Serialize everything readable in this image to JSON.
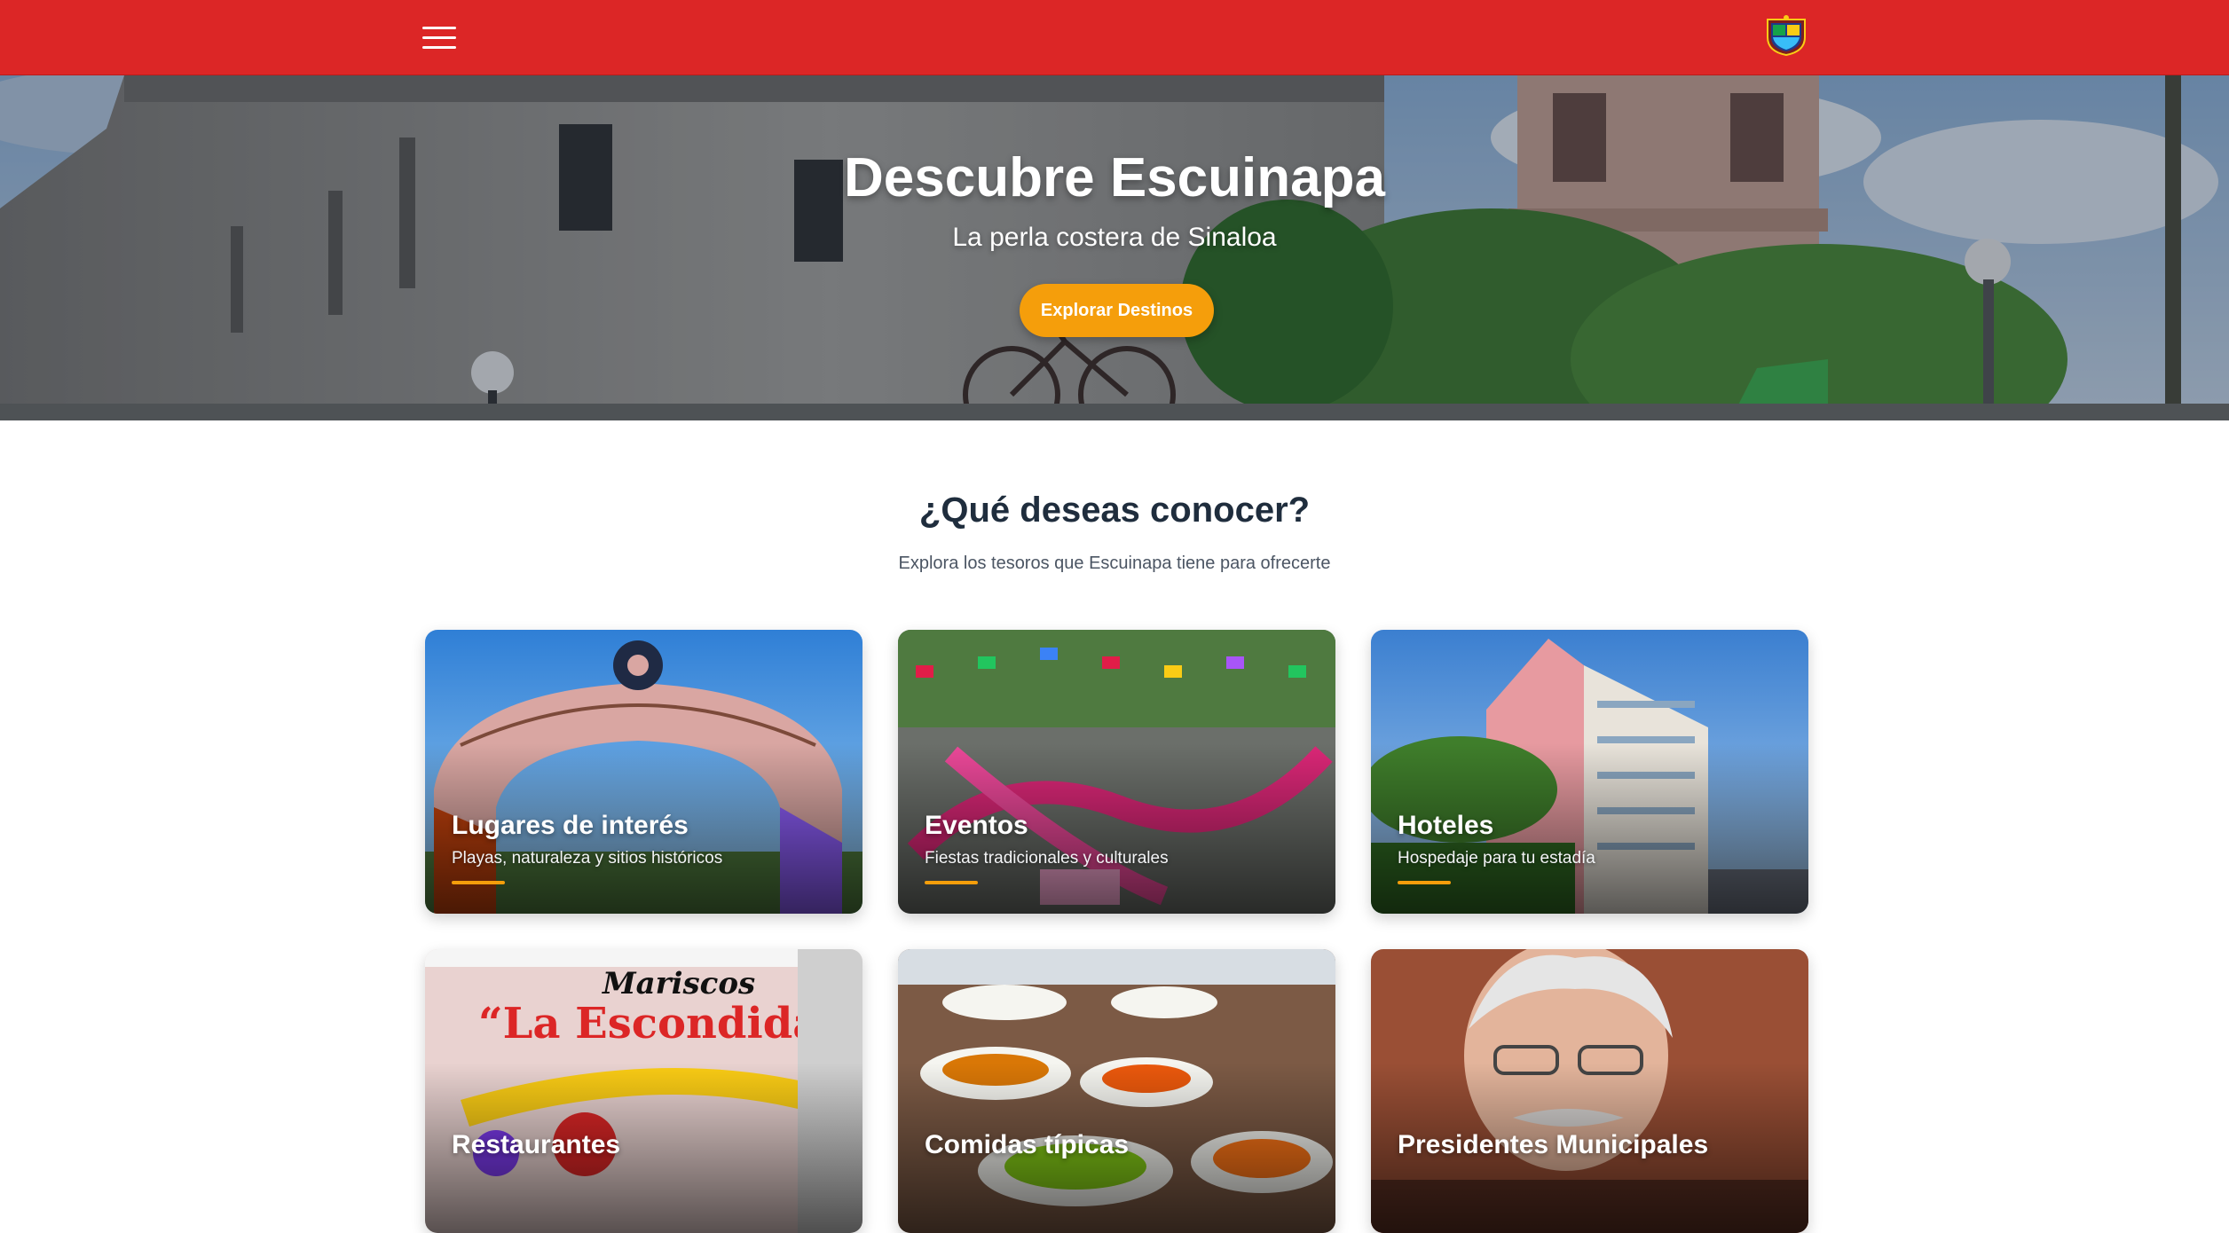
{
  "colors": {
    "navbar": "#dc2626",
    "accent": "#f59e0b",
    "heading": "#1f2d3d",
    "muted": "#4b5563"
  },
  "navbar": {
    "menu_icon": "hamburger-menu-icon",
    "logo_icon": "municipal-coat-of-arms-icon"
  },
  "hero": {
    "title": "Descubre Escuinapa",
    "subtitle": "La perla costera de Sinaloa",
    "button_label": "Explorar Destinos"
  },
  "section": {
    "title": "¿Qué deseas conocer?",
    "subtitle": "Explora los tesoros que Escuinapa tiene para ofrecerte"
  },
  "cards": [
    {
      "title": "Lugares de interés",
      "description": "Playas, naturaleza y sitios históricos"
    },
    {
      "title": "Eventos",
      "description": "Fiestas tradicionales y culturales"
    },
    {
      "title": "Hoteles",
      "description": "Hospedaje para tu estadía"
    },
    {
      "title": "Restaurantes",
      "description": ""
    },
    {
      "title": "Comidas típicas",
      "description": ""
    },
    {
      "title": "Presidentes Municipales",
      "description": ""
    }
  ]
}
